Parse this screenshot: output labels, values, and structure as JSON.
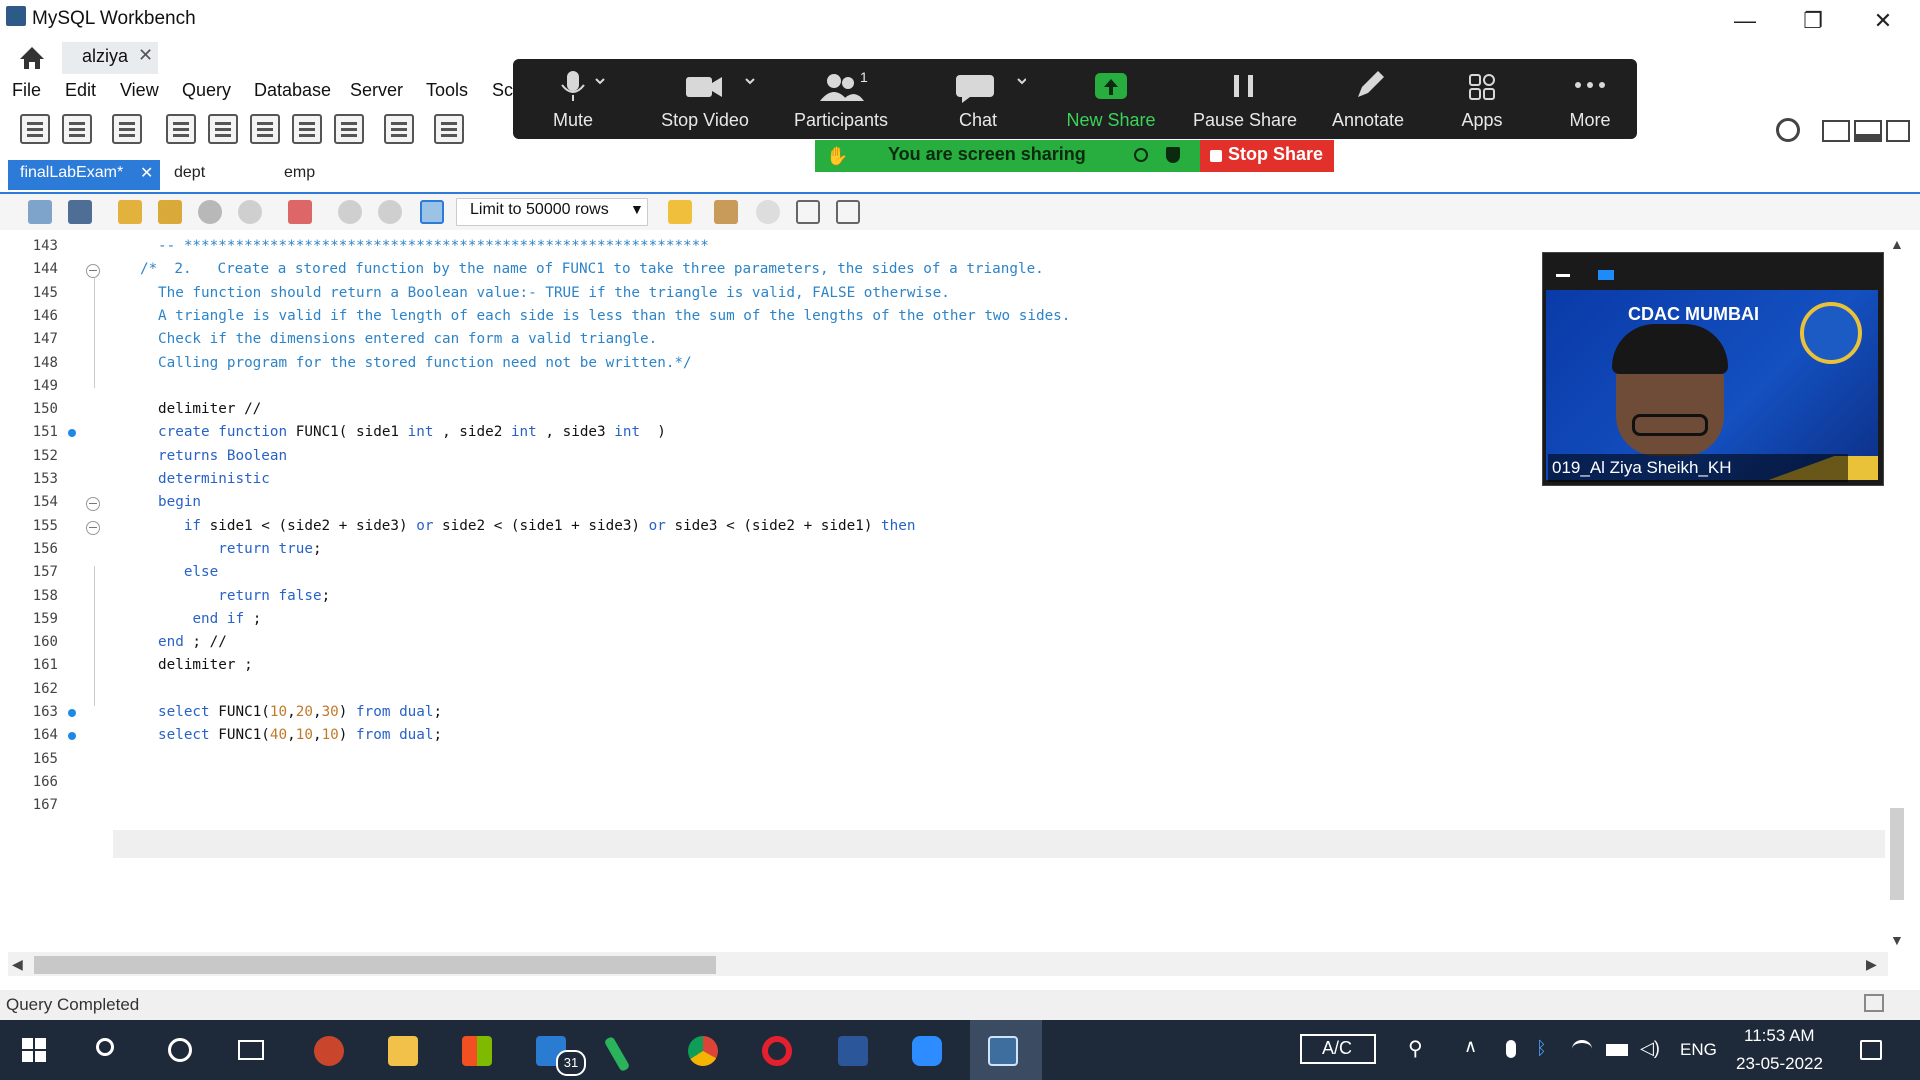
{
  "window": {
    "title": "MySQL Workbench",
    "min": "—",
    "restore": "❐",
    "close": "✕"
  },
  "connection_tab": {
    "label": "alziya",
    "close": "✕"
  },
  "menu": [
    "File",
    "Edit",
    "View",
    "Query",
    "Database",
    "Server",
    "Tools",
    "Sc"
  ],
  "zoom": {
    "buttons": [
      {
        "label": "Mute",
        "icon": "microphone-icon"
      },
      {
        "label": "Stop Video",
        "icon": "video-camera-icon"
      },
      {
        "label": "Participants",
        "icon": "participants-icon",
        "badge": "1"
      },
      {
        "label": "Chat",
        "icon": "chat-icon"
      },
      {
        "label": "New Share",
        "icon": "share-arrow-icon"
      },
      {
        "label": "Pause Share",
        "icon": "pause-icon"
      },
      {
        "label": "Annotate",
        "icon": "pencil-icon"
      },
      {
        "label": "Apps",
        "icon": "apps-icon"
      },
      {
        "label": "More",
        "icon": "more-dots-icon"
      }
    ],
    "share_banner": "You are screen sharing",
    "stop_share": "Stop Share",
    "accent": "#27ae3e"
  },
  "editor_tabs": {
    "active": "finalLabExam*",
    "close": "✕",
    "others": [
      "dept",
      "emp"
    ]
  },
  "sql_toolbar": {
    "limit": "Limit to 50000 rows"
  },
  "editor": {
    "lines": [
      {
        "n": "143",
        "text": "-- *************************************************************"
      },
      {
        "n": "144",
        "text": "/*  2.   Create a stored function by the name of FUNC1 to take three parameters, the sides of a triangle."
      },
      {
        "n": "145",
        "text": "The function should return a Boolean value:- TRUE if the triangle is valid, FALSE otherwise."
      },
      {
        "n": "146",
        "text": "A triangle is valid if the length of each side is less than the sum of the lengths of the other two sides."
      },
      {
        "n": "147",
        "text": "Check if the dimensions entered can form a valid triangle."
      },
      {
        "n": "148",
        "text": "Calling program for the stored function need not be written.*/"
      },
      {
        "n": "149",
        "text": ""
      },
      {
        "n": "150",
        "text": "delimiter //"
      },
      {
        "n": "151",
        "text": "create function FUNC1( side1 int , side2 int , side3 int  )"
      },
      {
        "n": "152",
        "text": "returns Boolean"
      },
      {
        "n": "153",
        "text": "deterministic"
      },
      {
        "n": "154",
        "text": "begin"
      },
      {
        "n": "155",
        "text": "   if side1 < (side2 + side3) or side2 < (side1 + side3) or side3 < (side2 + side1) then"
      },
      {
        "n": "156",
        "text": "       return true;"
      },
      {
        "n": "157",
        "text": "   else"
      },
      {
        "n": "158",
        "text": "       return false;"
      },
      {
        "n": "159",
        "text": "    end if ;"
      },
      {
        "n": "160",
        "text": "end ; //"
      },
      {
        "n": "161",
        "text": "delimiter ;"
      },
      {
        "n": "162",
        "text": ""
      },
      {
        "n": "163",
        "text": "select FUNC1(10,20,30) from dual;"
      },
      {
        "n": "164",
        "text": "select FUNC1(40,10,10) from dual;"
      },
      {
        "n": "165",
        "text": ""
      },
      {
        "n": "166",
        "text": ""
      },
      {
        "n": "167",
        "text": ""
      }
    ]
  },
  "video": {
    "banner": "CDAC MUMBAI",
    "participant": "019_Al Ziya Sheikh_KH"
  },
  "status": {
    "text": "Query Completed"
  },
  "taskbar": {
    "mail_badge": "31",
    "ac": "A/C",
    "lang": "ENG",
    "time": "11:53 AM",
    "date": "23-05-2022"
  }
}
